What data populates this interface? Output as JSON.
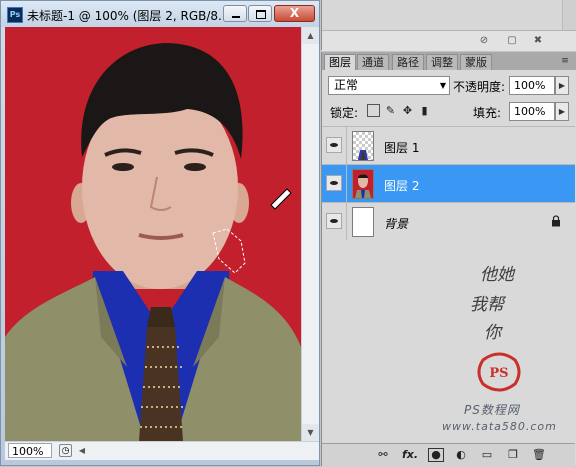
{
  "document": {
    "title": "未标题-1 @ 100% (图层 2, RGB/8...",
    "app_badge": "Ps",
    "zoom": "100%",
    "window_buttons": {
      "minimize_icon": "minimize-icon",
      "maximize_icon": "maximize-icon",
      "close_label": "X"
    }
  },
  "layers_panel": {
    "tabs": [
      {
        "label": "图层",
        "active": true
      },
      {
        "label": "通道",
        "active": false
      },
      {
        "label": "路径",
        "active": false
      },
      {
        "label": "调整",
        "active": false
      },
      {
        "label": "蒙版",
        "active": false
      }
    ],
    "blend_mode": "正常",
    "opacity_label": "不透明度:",
    "opacity_value": "100%",
    "lock_label": "锁定:",
    "fill_label": "填充:",
    "fill_value": "100%",
    "layers": [
      {
        "name": "图层 1",
        "visible": true,
        "selected": false,
        "thumbnail": "transparent-with-figure"
      },
      {
        "name": "图层 2",
        "visible": true,
        "selected": true,
        "thumbnail": "portrait-red"
      },
      {
        "name": "背景",
        "visible": true,
        "selected": false,
        "thumbnail": "white",
        "locked": true
      }
    ],
    "bottom_icons": [
      "link-icon",
      "fx-icon",
      "mask-icon",
      "adjustment-icon",
      "group-folder-icon",
      "new-layer-icon",
      "trash-icon"
    ],
    "bottom_fx_label": "fx."
  },
  "watermark": {
    "calligraphy_lines": [
      "他她",
      "我帮",
      "你"
    ],
    "seal_text": "PS",
    "title": "PS数程网",
    "url": "www.tata580.com"
  },
  "colors": {
    "selected_layer": "#3a98f4",
    "photo_background": "#c3202e",
    "jacket": "#8f8f6a",
    "shirt": "#1c2fb0"
  }
}
